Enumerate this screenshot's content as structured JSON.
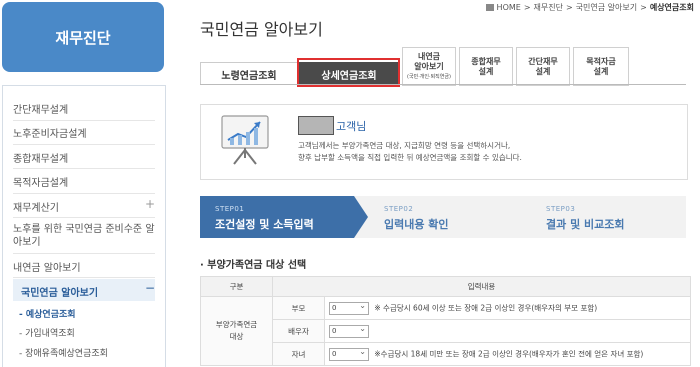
{
  "sidebar": {
    "title": "재무진단",
    "items": [
      {
        "label": "간단재무설계"
      },
      {
        "label": "노후준비자금설계"
      },
      {
        "label": "종합재무설계"
      },
      {
        "label": "목적자금설계"
      },
      {
        "label": "재무계산기",
        "expander": "+"
      },
      {
        "label": "노후를 위한 국민연금 준비수준 알아보기"
      },
      {
        "label": "내연금 알아보기"
      },
      {
        "label": "국민연금 알아보기",
        "expander": "−"
      }
    ],
    "subitems": [
      {
        "label": "- 예상연금조회"
      },
      {
        "label": "- 가입내역조회"
      },
      {
        "label": "- 장애유족예상연금조회"
      }
    ]
  },
  "breadcrumb": [
    "HOME",
    ">",
    "재무진단",
    ">",
    "국민연금 알아보기",
    ">",
    "예상연금조회"
  ],
  "page_title": "국민연금 알아보기",
  "tabs": {
    "old_age": "노령연금조회",
    "detail": "상세연금조회",
    "my_pension_1": "내연금",
    "my_pension_2": "알아보기",
    "my_pension_3": "(국민·개인·퇴직연금)",
    "total_1": "종합재무",
    "total_2": "설계",
    "simple_1": "간단재무",
    "simple_2": "설계",
    "purpose_1": "목적자금",
    "purpose_2": "설계"
  },
  "info": {
    "customer_suffix": "고객님",
    "description_line1": "고객님께서는 부양가족연금 대상, 지급희망 연령 등을 선택하시거나,",
    "description_line2": "향후 납부할 소득액을 직접 입력한 뒤 예상연금액을 조회할 수 있습니다."
  },
  "steps": [
    {
      "label": "STEP01",
      "title": "조건설정 및 소득입력"
    },
    {
      "label": "STEP02",
      "title": "입력내용 확인"
    },
    {
      "label": "STEP03",
      "title": "결과 및 비교조회"
    }
  ],
  "section_title": "· 부양가족연금 대상 선택",
  "table": {
    "header": [
      "구분",
      "입력내용"
    ],
    "group_label_1": "부양가족연금",
    "group_label_2": "대상",
    "rows": [
      {
        "label": "부모",
        "value": "0",
        "note": "※ 수급당시 60세 이상 또는 장애 2급 이상인 경우(배우자의 부모 포함)"
      },
      {
        "label": "배우자",
        "value": "0",
        "note": ""
      },
      {
        "label": "자녀",
        "value": "0",
        "note": "※수급당시 18세 미만 또는 장애 2급 이상인 경우(배우자가 혼인 전에 얻은 자녀 포함)"
      }
    ]
  },
  "colors": {
    "brand": "#4a89c8",
    "active_step": "#3d6fa8",
    "highlight": "#e03030",
    "link": "#2a62a8"
  }
}
